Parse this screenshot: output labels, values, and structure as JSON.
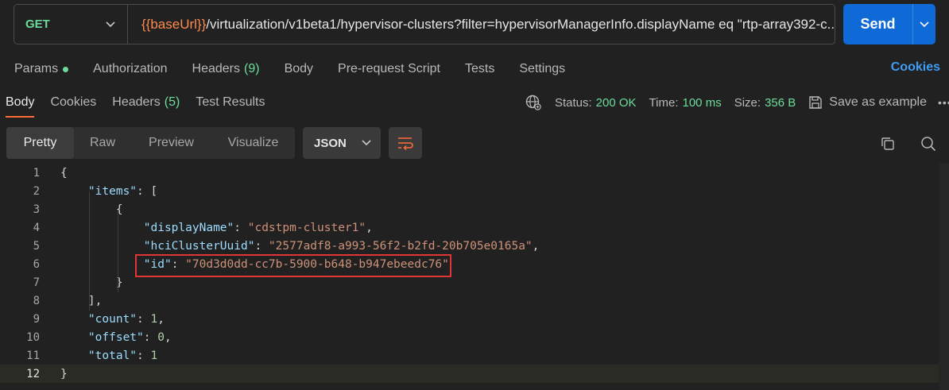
{
  "request": {
    "method": "GET",
    "url_variable": "{{baseUrl}}",
    "url_path": "/virtualization/v1beta1/hypervisor-clusters?filter=hypervisorManagerInfo.displayName eq \"rtp-array392-c...",
    "send_label": "Send"
  },
  "request_tabs": {
    "params": "Params",
    "authorization": "Authorization",
    "headers": "Headers",
    "headers_count": "(9)",
    "body": "Body",
    "prerequest": "Pre-request Script",
    "tests": "Tests",
    "settings": "Settings",
    "cookies": "Cookies"
  },
  "response_tabs": {
    "body": "Body",
    "cookies": "Cookies",
    "headers": "Headers",
    "headers_count": "(5)",
    "test_results": "Test Results"
  },
  "status": {
    "status_label": "Status:",
    "status_value": "200 OK",
    "time_label": "Time:",
    "time_value": "100 ms",
    "size_label": "Size:",
    "size_value": "356 B",
    "save_example": "Save as example",
    "more": "•••"
  },
  "view": {
    "modes": [
      "Pretty",
      "Raw",
      "Preview",
      "Visualize"
    ],
    "format": "JSON"
  },
  "code_lines": [
    {
      "n": "1",
      "parts": [
        [
          "p",
          "{"
        ]
      ]
    },
    {
      "n": "2",
      "parts": [
        [
          "p",
          "    "
        ],
        [
          "k",
          "\"items\""
        ],
        [
          "p",
          ": ["
        ]
      ]
    },
    {
      "n": "3",
      "parts": [
        [
          "p",
          "        {"
        ]
      ]
    },
    {
      "n": "4",
      "parts": [
        [
          "p",
          "            "
        ],
        [
          "k",
          "\"displayName\""
        ],
        [
          "p",
          ": "
        ],
        [
          "s",
          "\"cdstpm-cluster1\""
        ],
        [
          "p",
          ","
        ]
      ]
    },
    {
      "n": "5",
      "parts": [
        [
          "p",
          "            "
        ],
        [
          "k",
          "\"hciClusterUuid\""
        ],
        [
          "p",
          ": "
        ],
        [
          "s",
          "\"2577adf8-a993-56f2-b2fd-20b705e0165a\""
        ],
        [
          "p",
          ","
        ]
      ]
    },
    {
      "n": "6",
      "parts": [
        [
          "p",
          "            "
        ],
        [
          "k",
          "\"id\""
        ],
        [
          "p",
          ": "
        ],
        [
          "s",
          "\"70d3d0dd-cc7b-5900-b648-b947ebeedc76\""
        ]
      ]
    },
    {
      "n": "7",
      "parts": [
        [
          "p",
          "        }"
        ]
      ]
    },
    {
      "n": "8",
      "parts": [
        [
          "p",
          "    ],"
        ]
      ]
    },
    {
      "n": "9",
      "parts": [
        [
          "p",
          "    "
        ],
        [
          "k",
          "\"count\""
        ],
        [
          "p",
          ": "
        ],
        [
          "n",
          "1"
        ],
        [
          "p",
          ","
        ]
      ]
    },
    {
      "n": "10",
      "parts": [
        [
          "p",
          "    "
        ],
        [
          "k",
          "\"offset\""
        ],
        [
          "p",
          ": "
        ],
        [
          "n",
          "0"
        ],
        [
          "p",
          ","
        ]
      ]
    },
    {
      "n": "11",
      "parts": [
        [
          "p",
          "    "
        ],
        [
          "k",
          "\"total\""
        ],
        [
          "p",
          ": "
        ],
        [
          "n",
          "1"
        ]
      ]
    },
    {
      "n": "12",
      "parts": [
        [
          "p",
          "}"
        ]
      ]
    }
  ],
  "current_line": "12",
  "colors": {
    "accent": "#ff6c37",
    "send": "#0f6ad7",
    "success": "#6bdd9a",
    "highlight_box": "#e03535"
  }
}
